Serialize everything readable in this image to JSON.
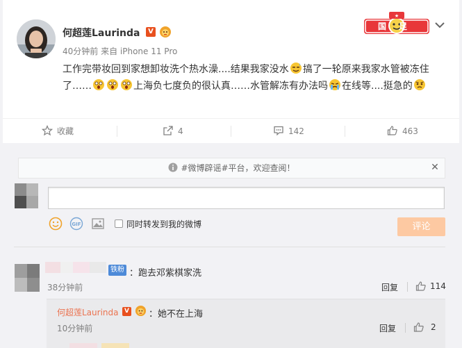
{
  "post": {
    "username": "何超莲Laurinda",
    "verified_badge": "V",
    "meta": "40分钟前 来自 iPhone 11 Pro",
    "text_parts": [
      "工作完带妆回到家想卸妆洗个热水澡....结果我家没水",
      "搞了一轮原来我家水管被冻住了……",
      "上海负七度负的很认真……水管解冻有办法吗",
      "在线等....挺急的"
    ],
    "brand_badge_text": "国足加油",
    "menu_icon": "chevron-down-icon"
  },
  "actions": {
    "favorite_label": "收藏",
    "repost_count": "4",
    "comment_count": "142",
    "like_count": "463"
  },
  "comment_area": {
    "notice_text": "#微博辟谣#平台，欢迎查阅！",
    "input_value": "",
    "repost_checkbox_label": "同时转发到我的微博",
    "submit_label": "评论"
  },
  "comments": [
    {
      "fan_badge": "铁粉",
      "text": "：跑去邓紫棋家洗",
      "time": "38分钟前",
      "reply_label": "回复",
      "likes": "114",
      "sub_reply": {
        "name": "何超莲Laurinda",
        "text": "：她不在上海",
        "time": "10分钟前",
        "reply_label": "回复",
        "likes": "2"
      }
    }
  ],
  "colors": {
    "accent_orange": "#eb7350",
    "submit_disabled": "#fdc9a2",
    "verified_orange": "#e8501e",
    "fan_badge_blue": "#4d8ad8",
    "muted_text": "#808080"
  }
}
